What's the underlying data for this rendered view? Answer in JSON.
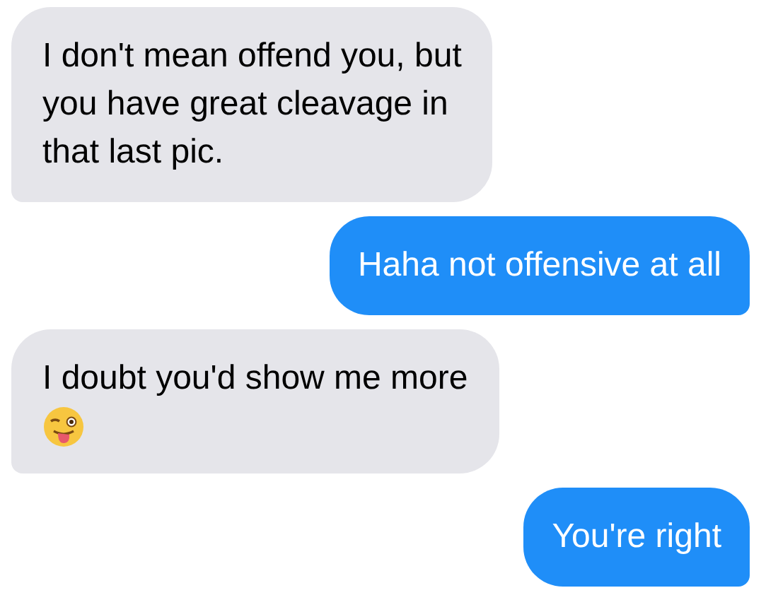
{
  "messages": [
    {
      "kind": "received",
      "text": "I don't mean offend you, but\nyou have great cleavage in\nthat last pic.",
      "emoji": false
    },
    {
      "kind": "sent",
      "text": "Haha not offensive at all",
      "emoji": false
    },
    {
      "kind": "received",
      "text": "I doubt you'd show me more",
      "emoji": true
    },
    {
      "kind": "sent",
      "text": "You're right",
      "emoji": false
    }
  ]
}
